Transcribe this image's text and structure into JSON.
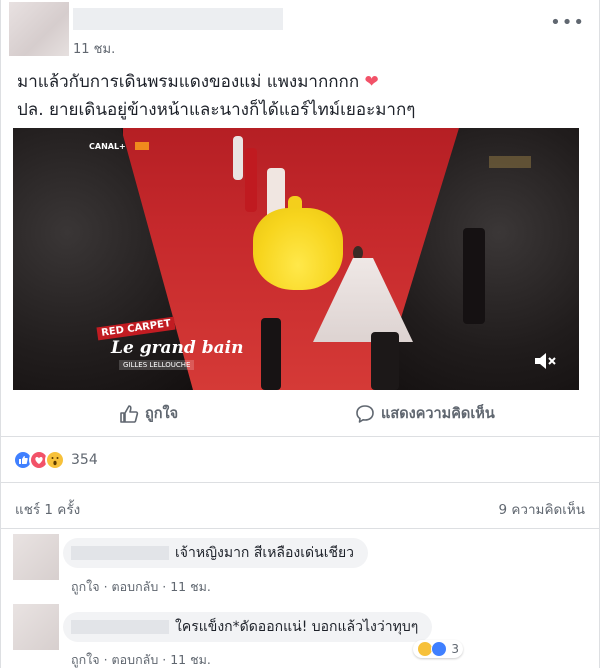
{
  "post": {
    "timestamp": "11 ชม.",
    "text_line1": "มาแล้วกับการเดินพรมแดงของแม่ แพงมากกกก",
    "text_line2": "ปล. ยายเดินอยู่ข้างหน้าและนางก็ได้แอร์ไทม์เยอะมากๆ",
    "heart_emoji": "❤"
  },
  "video": {
    "channel_label": "CANAL+",
    "tag": "RED CARPET",
    "title": "Le grand bain",
    "subtitle": "GILLES LELLOUCHE"
  },
  "actions": {
    "like": "ถูกใจ",
    "comment": "แสดงความคิดเห็น"
  },
  "reactions": {
    "count": "354"
  },
  "stats": {
    "shares": "แชร์ 1 ครั้ง",
    "comments": "9 ความคิดเห็น"
  },
  "comments": [
    {
      "text": "เจ้าหญิงมาก สีเหลืองเด่นเชียว",
      "like": "ถูกใจ",
      "reply": "ตอบกลับ",
      "time": "11 ชม.",
      "separator": "·"
    },
    {
      "text": "ใครแข็งก*ดัดออกแน่! บอกแล้วไงว่าทุบๆ",
      "like": "ถูกใจ",
      "reply": "ตอบกลับ",
      "time": "11 ชม.",
      "separator": "·",
      "reaction_count": "3"
    }
  ],
  "colors": {
    "accent": "#4080ff",
    "love": "#f25268",
    "wow": "#f7c13a",
    "meta_text": "#606770"
  }
}
